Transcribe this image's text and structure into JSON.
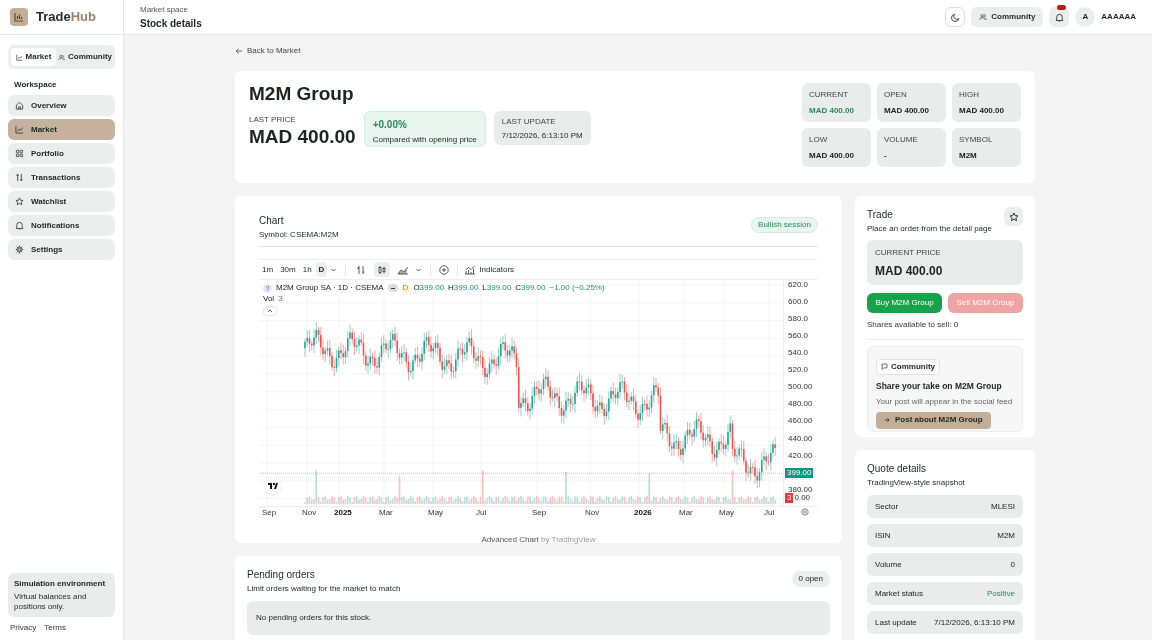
{
  "brand": {
    "name_a": "Trade",
    "name_b": "Hub"
  },
  "header": {
    "eyebrow": "Market space",
    "title": "Stock details",
    "community_button": "Community",
    "notifications_unread": true,
    "avatar_letter": "A",
    "user_name": "AAAAAA"
  },
  "sidebar": {
    "switch": [
      {
        "label": "Market",
        "kind": "chart",
        "selected": true
      },
      {
        "label": "Community",
        "kind": "users",
        "selected": false
      }
    ],
    "section": "Workspace",
    "items": [
      {
        "label": "Overview",
        "kind": "home",
        "selected": false
      },
      {
        "label": "Market",
        "kind": "chart",
        "selected": true
      },
      {
        "label": "Portfolio",
        "kind": "grid",
        "selected": false
      },
      {
        "label": "Transactions",
        "kind": "arrows",
        "selected": false
      },
      {
        "label": "Watchlist",
        "kind": "star",
        "selected": false
      },
      {
        "label": "Notifications",
        "kind": "bell",
        "selected": false
      },
      {
        "label": "Settings",
        "kind": "gear",
        "selected": false
      }
    ],
    "notice": {
      "title": "Simulation environment",
      "text": "Virtual balances and positions only."
    },
    "footer_links": [
      "Privacy",
      "Terms"
    ]
  },
  "back_link": "Back to Market",
  "stock": {
    "name": "M2M Group",
    "last_price_label": "LAST PRICE",
    "last_price": "MAD 400.00",
    "change": "+0.00%",
    "change_note": "Compared with opening price",
    "update_label": "LAST UPDATE",
    "update_value": "7/12/2026, 6:13:10 PM",
    "stats": [
      {
        "label": "CURRENT",
        "value": "MAD 400.00",
        "highlight": true
      },
      {
        "label": "OPEN",
        "value": "MAD 400.00",
        "highlight": false
      },
      {
        "label": "HIGH",
        "value": "MAD 400.00",
        "highlight": false
      },
      {
        "label": "LOW",
        "value": "MAD 400.00",
        "highlight": false
      },
      {
        "label": "VOLUME",
        "value": "-",
        "highlight": false
      },
      {
        "label": "SYMBOL",
        "value": "M2M",
        "highlight": false
      }
    ]
  },
  "chart": {
    "title": "Chart",
    "subtitle": "Symbol: CSEMA:M2M",
    "badge": "Bullish session",
    "toolbar": {
      "intervals": [
        {
          "label": "1m",
          "selected": false
        },
        {
          "label": "30m",
          "selected": false
        },
        {
          "label": "1h",
          "selected": false
        },
        {
          "label": "D",
          "selected": true
        }
      ],
      "indicators": "Indicators"
    },
    "legend": {
      "help": "?",
      "title": "M2M Group SA · 1D · CSEMA",
      "flag": "D",
      "ohlc": [
        {
          "label": "O",
          "value": "399.00"
        },
        {
          "label": "H",
          "value": "399.00"
        },
        {
          "label": "L",
          "value": "399.00"
        },
        {
          "label": "C",
          "value": "399.00"
        }
      ],
      "change": "−1.00 (−0.25%)",
      "volume_label": "Vol",
      "volume_value": "3"
    },
    "price_ticks": [
      "620.0",
      "600.0",
      "580.0",
      "560.0",
      "540.0",
      "520.0",
      "500.00",
      "480.00",
      "460.00",
      "440.00",
      "420.00",
      "380.00"
    ],
    "last_price_badge": "399.00",
    "volume_badge": "3",
    "volume_tick": "0.00",
    "time_labels": [
      {
        "label": "Sep",
        "kind": "month"
      },
      {
        "label": "Nov",
        "kind": "month"
      },
      {
        "label": "2025",
        "kind": "year"
      },
      {
        "label": "Mar",
        "kind": "month"
      },
      {
        "label": "May",
        "kind": "month"
      },
      {
        "label": "Jul",
        "kind": "month"
      },
      {
        "label": "Sep",
        "kind": "month"
      },
      {
        "label": "Nov",
        "kind": "month"
      },
      {
        "label": "2026",
        "kind": "year"
      },
      {
        "label": "Mar",
        "kind": "month"
      },
      {
        "label": "May",
        "kind": "month"
      },
      {
        "label": "Jul",
        "kind": "month"
      }
    ],
    "credit_a": "Advanced Chart",
    "credit_b": "by TradingView"
  },
  "pending": {
    "title": "Pending orders",
    "subtitle": "Limit orders waiting for the market to match",
    "count": "0 open",
    "empty": "No pending orders for this stock."
  },
  "trade": {
    "title": "Trade",
    "subtitle": "Place an order from the detail page",
    "price_label": "CURRENT PRICE",
    "price": "MAD 400.00",
    "buy": "Buy M2M Group",
    "sell": "Sell M2M Group",
    "sell_disabled": true,
    "shares": "Shares available to sell: 0",
    "community": {
      "tag": "Community",
      "title": "Share your take on M2M Group",
      "text": "Your post will appear in the social feed",
      "button": "Post about M2M Group"
    }
  },
  "quote": {
    "title": "Quote details",
    "subtitle": "TradingView-style snapshot",
    "rows": [
      {
        "label": "Sector",
        "value": "MLESI",
        "positive": false
      },
      {
        "label": "ISIN",
        "value": "M2M",
        "positive": false
      },
      {
        "label": "Volume",
        "value": "0",
        "positive": false
      },
      {
        "label": "Market status",
        "value": "Positive",
        "positive": true
      },
      {
        "label": "Last update",
        "value": "7/12/2026, 6:13:10 PM",
        "positive": false
      }
    ]
  }
}
